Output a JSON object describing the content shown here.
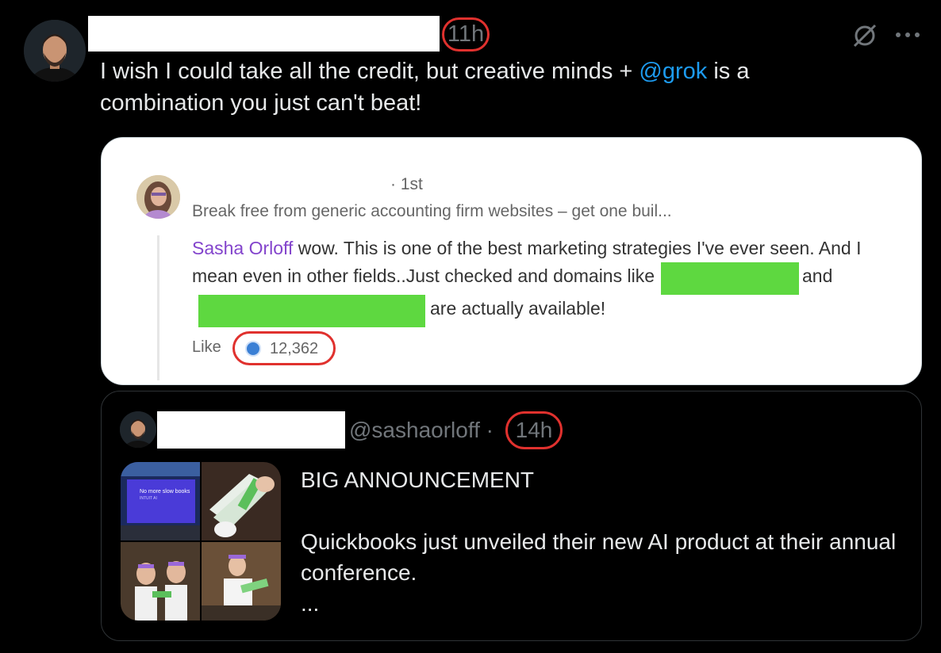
{
  "post": {
    "time": "11h",
    "text_before": "I wish I could take all the credit, but creative minds + ",
    "mention": "@grok",
    "text_after": " is a combination you just can't beat!"
  },
  "card": {
    "degree": "· 1st",
    "headline": "Break free from generic accounting firm websites – get one buil...",
    "comment_author": "Sasha Orloff",
    "comment_text_1": " wow. This is one of the best marketing strategies I've ever seen. And I mean even in other fields..Just checked and domains like",
    "comment_and": "and",
    "comment_text_2": "are actually available!",
    "like_label": "Like",
    "reaction_count": "12,362"
  },
  "quote": {
    "handle": "@sashaorloff ·",
    "time": "14h",
    "title": "BIG ANNOUNCEMENT",
    "body": "Quickbooks just unveiled their new AI product at their annual conference.",
    "ellipsis": "...",
    "image_caption": "No more slow books",
    "image_subcaption": "INTUIT AI"
  },
  "colors": {
    "background": "#000000",
    "mention": "#1d9bf0",
    "highlight_circle": "#e0312e",
    "redaction_green": "#5ed840",
    "author_purple": "#8344cc"
  }
}
